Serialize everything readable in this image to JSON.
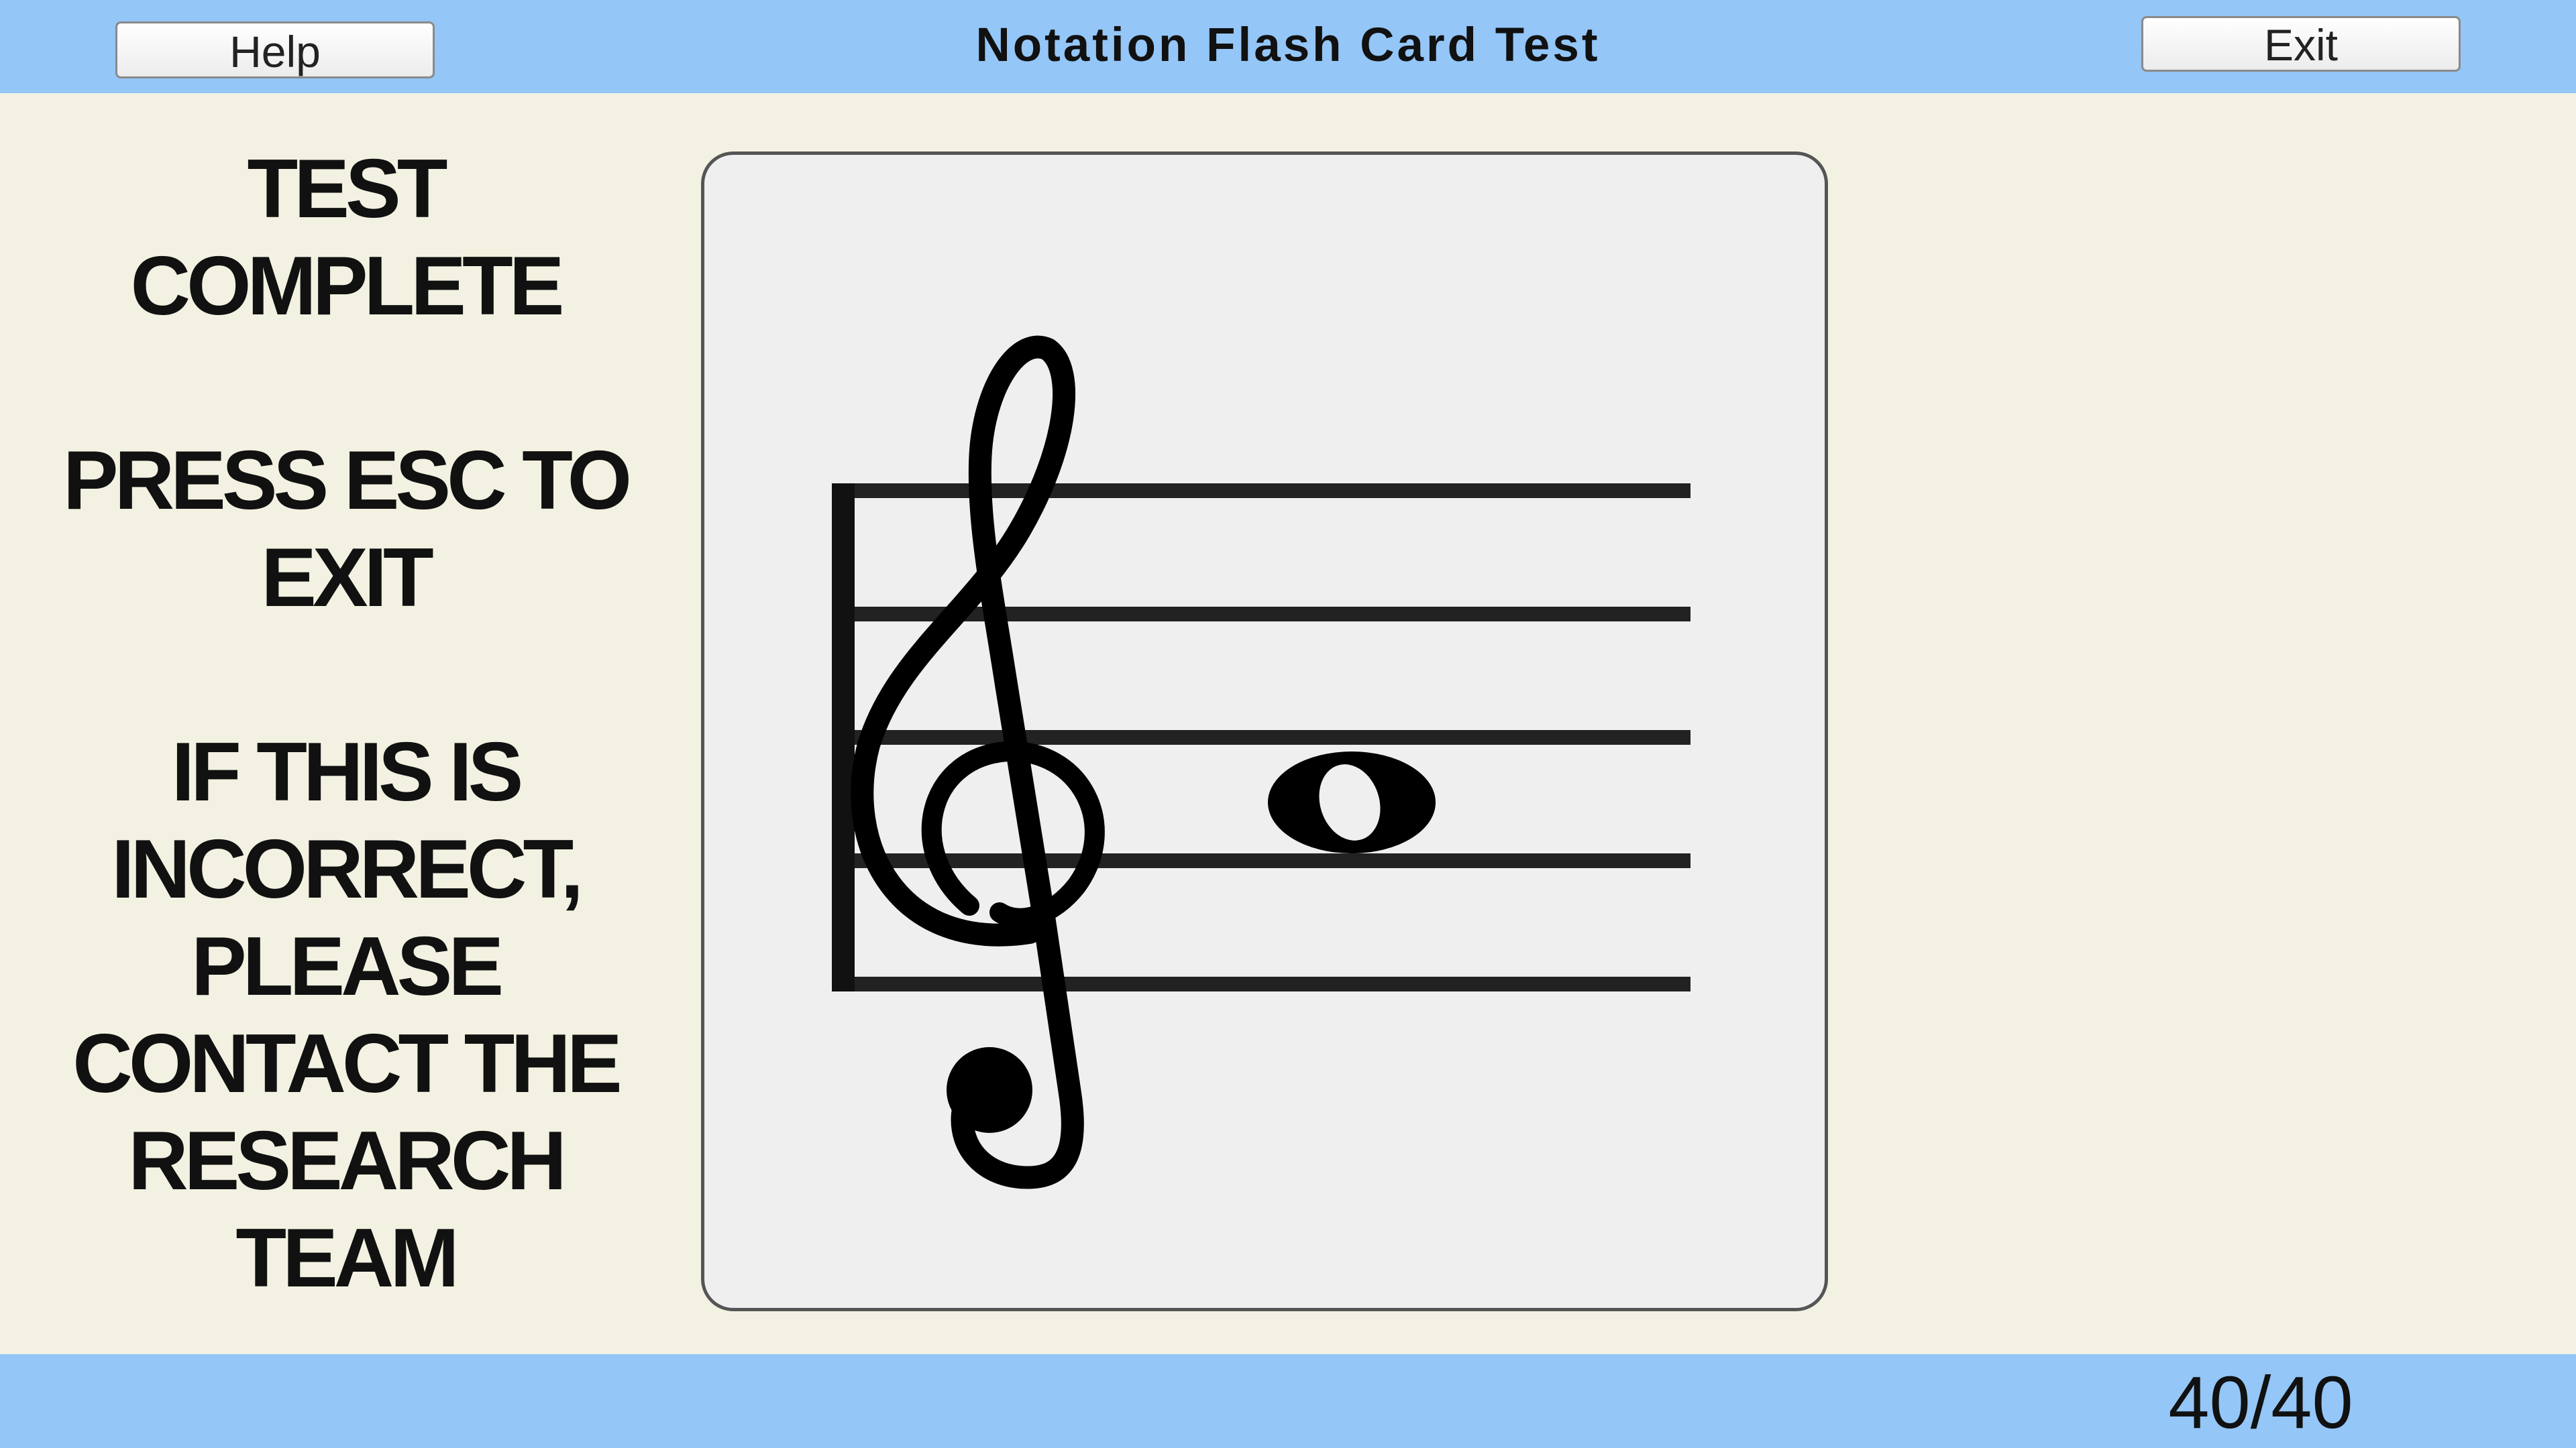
{
  "header": {
    "title": "Notation Flash Card Test",
    "help_label": "Help",
    "exit_label": "Exit"
  },
  "message": {
    "line1": "TEST",
    "line2": "COMPLETE",
    "line3": "PRESS ESC TO",
    "line4": "EXIT",
    "line5": "IF THIS IS",
    "line6": "INCORRECT,",
    "line7": "PLEASE",
    "line8": "CONTACT THE",
    "line9": "RESEARCH",
    "line10": "TEAM"
  },
  "flash_card": {
    "clef": "treble-clef-icon",
    "note": "whole-note-icon",
    "staff_lines": 5
  },
  "footer": {
    "progress": "40/40"
  },
  "colors": {
    "bar": "#94c6f7",
    "background": "#f3f2e2",
    "card": "#efefef"
  }
}
